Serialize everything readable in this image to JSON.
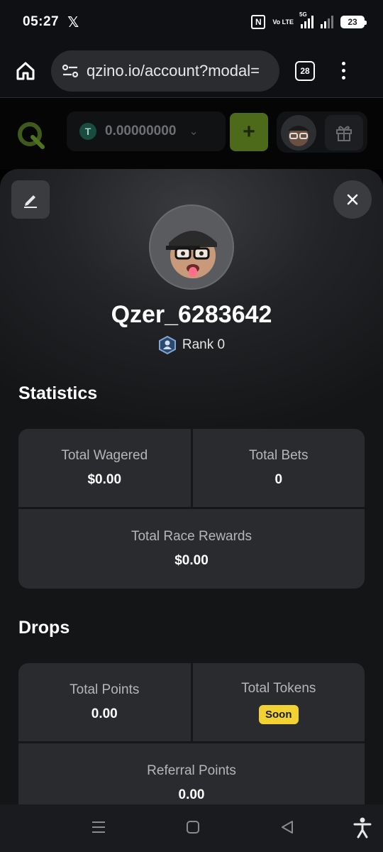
{
  "status_bar": {
    "time": "05:27",
    "x_logo": "𝕏",
    "nfc": "N",
    "volte": "Vo LTE",
    "network": "5G",
    "battery": "23"
  },
  "browser": {
    "url": "qzino.io/account?modal=",
    "tab_count": "28",
    "icons": [
      "home-icon",
      "site-settings-icon",
      "tabs-icon",
      "menu-icon"
    ]
  },
  "app_header": {
    "wallet_currency_symbol": "T",
    "wallet_amount": "0.00000000",
    "add_label": "+",
    "accent": "#7bbd1e"
  },
  "profile": {
    "username": "Qzer_6283642",
    "rank_label": "Rank 0"
  },
  "statistics": {
    "title": "Statistics",
    "total_wagered_label": "Total Wagered",
    "total_wagered_value": "$0.00",
    "total_bets_label": "Total Bets",
    "total_bets_value": "0",
    "total_race_rewards_label": "Total Race Rewards",
    "total_race_rewards_value": "$0.00"
  },
  "drops": {
    "title": "Drops",
    "total_points_label": "Total Points",
    "total_points_value": "0.00",
    "total_tokens_label": "Total Tokens",
    "total_tokens_badge": "Soon",
    "referral_points_label": "Referral Points",
    "referral_points_value": "0.00",
    "badge_color": "#f2d233"
  }
}
